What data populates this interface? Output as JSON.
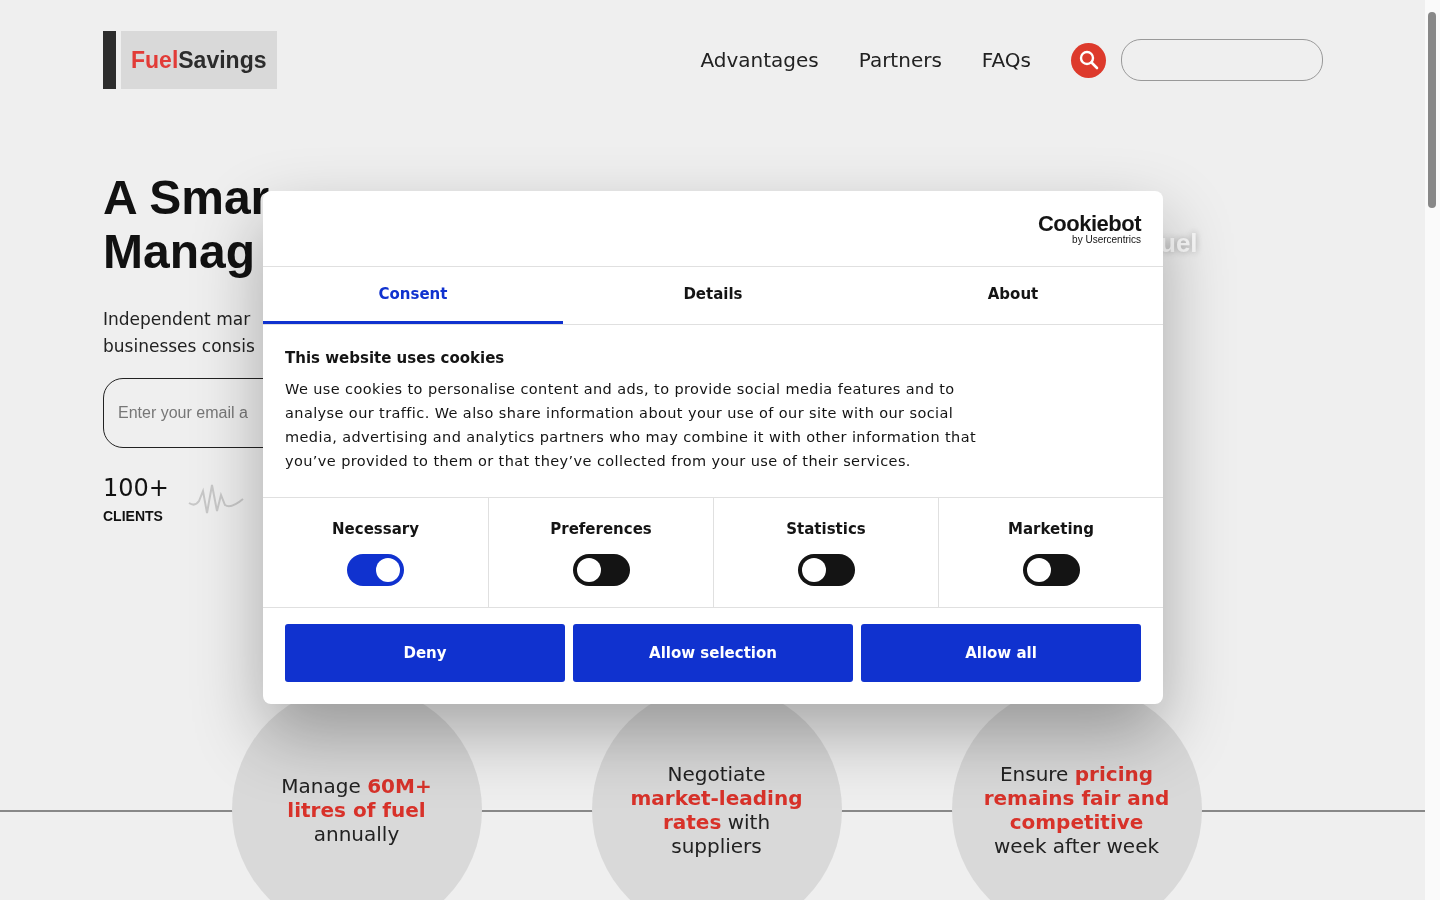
{
  "header": {
    "logo": {
      "first": "Fuel",
      "second": "Savings"
    },
    "nav": [
      {
        "label": "Advantages"
      },
      {
        "label": "Partners"
      },
      {
        "label": "FAQs"
      }
    ]
  },
  "hero": {
    "heading_lines": [
      "A Smar",
      "Manag"
    ],
    "description_lines": [
      "Independent mar",
      "businesses consis"
    ],
    "email": {
      "placeholder": "Enter your email a"
    },
    "stat": {
      "value": "100+",
      "label": "CLIENTS"
    },
    "side_text": "uel"
  },
  "features": [
    {
      "text": "Manage **60M+ litres of fuel** annually"
    },
    {
      "text": "Negotiate **market-leading rates** with suppliers"
    },
    {
      "text": "Ensure **pricing remains fair and competitive** week after week"
    }
  ],
  "cookie_dialog": {
    "brand": "Cookiebot",
    "brand_sub": "by Usercentrics",
    "tabs": [
      {
        "label": "Consent",
        "selected": true
      },
      {
        "label": "Details",
        "selected": false
      },
      {
        "label": "About",
        "selected": false
      }
    ],
    "title": "This website uses cookies",
    "body": "We use cookies to personalise content and ads, to provide social media features and to analyse our traffic. We also share information about your use of our site with our social media, advertising and analytics partners who may combine it with other information that you’ve provided to them or that they’ve collected from your use of their services.",
    "categories": [
      {
        "label": "Necessary",
        "on": true
      },
      {
        "label": "Preferences",
        "on": false
      },
      {
        "label": "Statistics",
        "on": false
      },
      {
        "label": "Marketing",
        "on": false
      }
    ],
    "buttons": [
      {
        "label": "Deny"
      },
      {
        "label": "Allow selection"
      },
      {
        "label": "Allow all"
      }
    ]
  }
}
